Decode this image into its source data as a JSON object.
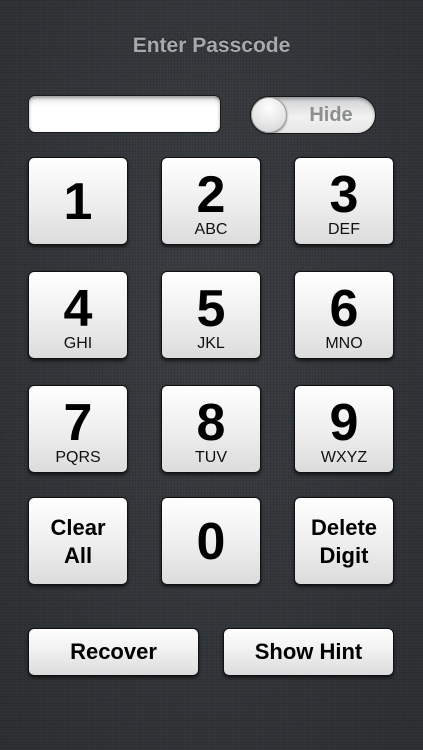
{
  "header": {
    "title": "Enter Passcode"
  },
  "passcode": {
    "value": "",
    "placeholder": ""
  },
  "hide_toggle": {
    "label": "Hide",
    "state": "off"
  },
  "keypad": {
    "k1": {
      "digit": "1",
      "letters": ""
    },
    "k2": {
      "digit": "2",
      "letters": "ABC"
    },
    "k3": {
      "digit": "3",
      "letters": "DEF"
    },
    "k4": {
      "digit": "4",
      "letters": "GHI"
    },
    "k5": {
      "digit": "5",
      "letters": "JKL"
    },
    "k6": {
      "digit": "6",
      "letters": "MNO"
    },
    "k7": {
      "digit": "7",
      "letters": "PQRS"
    },
    "k8": {
      "digit": "8",
      "letters": "TUV"
    },
    "k9": {
      "digit": "9",
      "letters": "WXYZ"
    },
    "k0": {
      "digit": "0",
      "letters": ""
    },
    "clear_all": "Clear\nAll",
    "delete_digit": "Delete\nDigit"
  },
  "actions": {
    "recover": "Recover",
    "show_hint": "Show Hint"
  },
  "colors": {
    "background": "#303336",
    "title_text": "#a7a9ac",
    "key_face": "#f1f1f1",
    "key_text": "#000000"
  }
}
